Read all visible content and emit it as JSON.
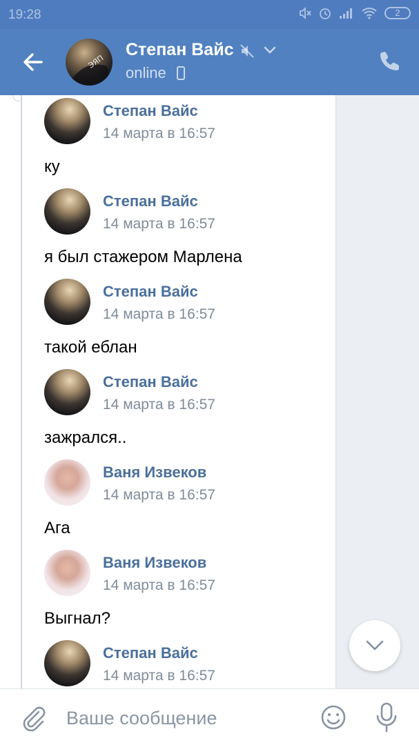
{
  "status_bar": {
    "time": "19:28",
    "battery": "2"
  },
  "header": {
    "name": "Степан Вайс",
    "status": "online"
  },
  "messages": [
    {
      "author": "Степан Вайс",
      "time": "14 марта в 16:57",
      "text": "",
      "avatar": "stepan"
    },
    {
      "author": "Степан Вайс",
      "time": "14 марта в 16:57",
      "text": "ку",
      "avatar": "stepan"
    },
    {
      "author": "Степан Вайс",
      "time": "14 марта в 16:57",
      "text": "я был стажером Марлена",
      "avatar": "stepan"
    },
    {
      "author": "Степан Вайс",
      "time": "14 марта в 16:57",
      "text": "такой еблан",
      "avatar": "stepan"
    },
    {
      "author": "Ваня Извеков",
      "time": "14 марта в 16:57",
      "text": "зажрался..",
      "avatar": "vanya"
    },
    {
      "author": "Ваня Извеков",
      "time": "14 марта в 16:57",
      "text": "Ага",
      "avatar": "vanya"
    },
    {
      "author": "Степан Вайс",
      "time": "14 марта в 16:57",
      "text": "Выгнал?",
      "avatar": "stepan"
    }
  ],
  "composer": {
    "placeholder": "Ваше сообщение"
  },
  "colors": {
    "header": "#5181c0",
    "status_bar": "#4f7cbf",
    "author": "#4a6f9c",
    "background": "#ebeef2"
  }
}
